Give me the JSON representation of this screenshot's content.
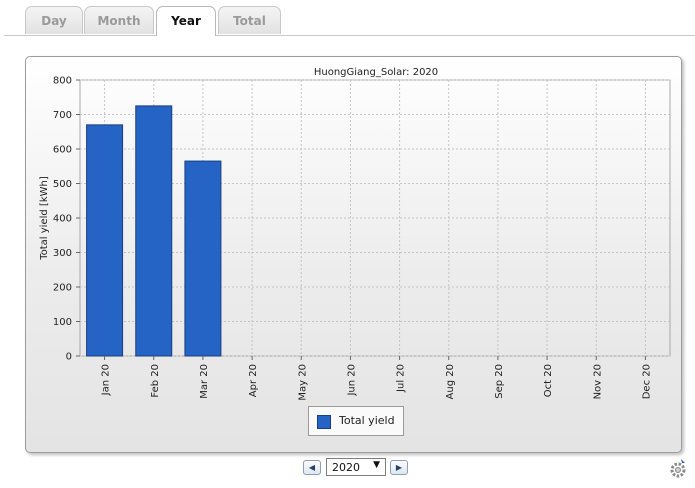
{
  "tabs": [
    {
      "label": "Day",
      "active": false
    },
    {
      "label": "Month",
      "active": false
    },
    {
      "label": "Year",
      "active": true
    },
    {
      "label": "Total",
      "active": false
    }
  ],
  "chart_data": {
    "type": "bar",
    "title": "HuongGiang_Solar: 2020",
    "xlabel": "",
    "ylabel": "Total yield [kWh]",
    "ylim": [
      0,
      800
    ],
    "yticks": [
      0,
      100,
      200,
      300,
      400,
      500,
      600,
      700,
      800
    ],
    "grid": true,
    "categories": [
      "Jan 20",
      "Feb 20",
      "Mar 20",
      "Apr 20",
      "May 20",
      "Jun 20",
      "Jul 20",
      "Aug 20",
      "Sep 20",
      "Oct 20",
      "Nov 20",
      "Dec 20"
    ],
    "series": [
      {
        "name": "Total yield",
        "color": "#2563c4",
        "values": [
          670,
          725,
          565,
          null,
          null,
          null,
          null,
          null,
          null,
          null,
          null,
          null
        ]
      }
    ],
    "legend_position": "bottom-center"
  },
  "controls": {
    "prev_icon": "left-arrow-icon",
    "next_icon": "right-arrow-icon",
    "year_selected": "2020",
    "settings_icon": "gear-icon"
  }
}
